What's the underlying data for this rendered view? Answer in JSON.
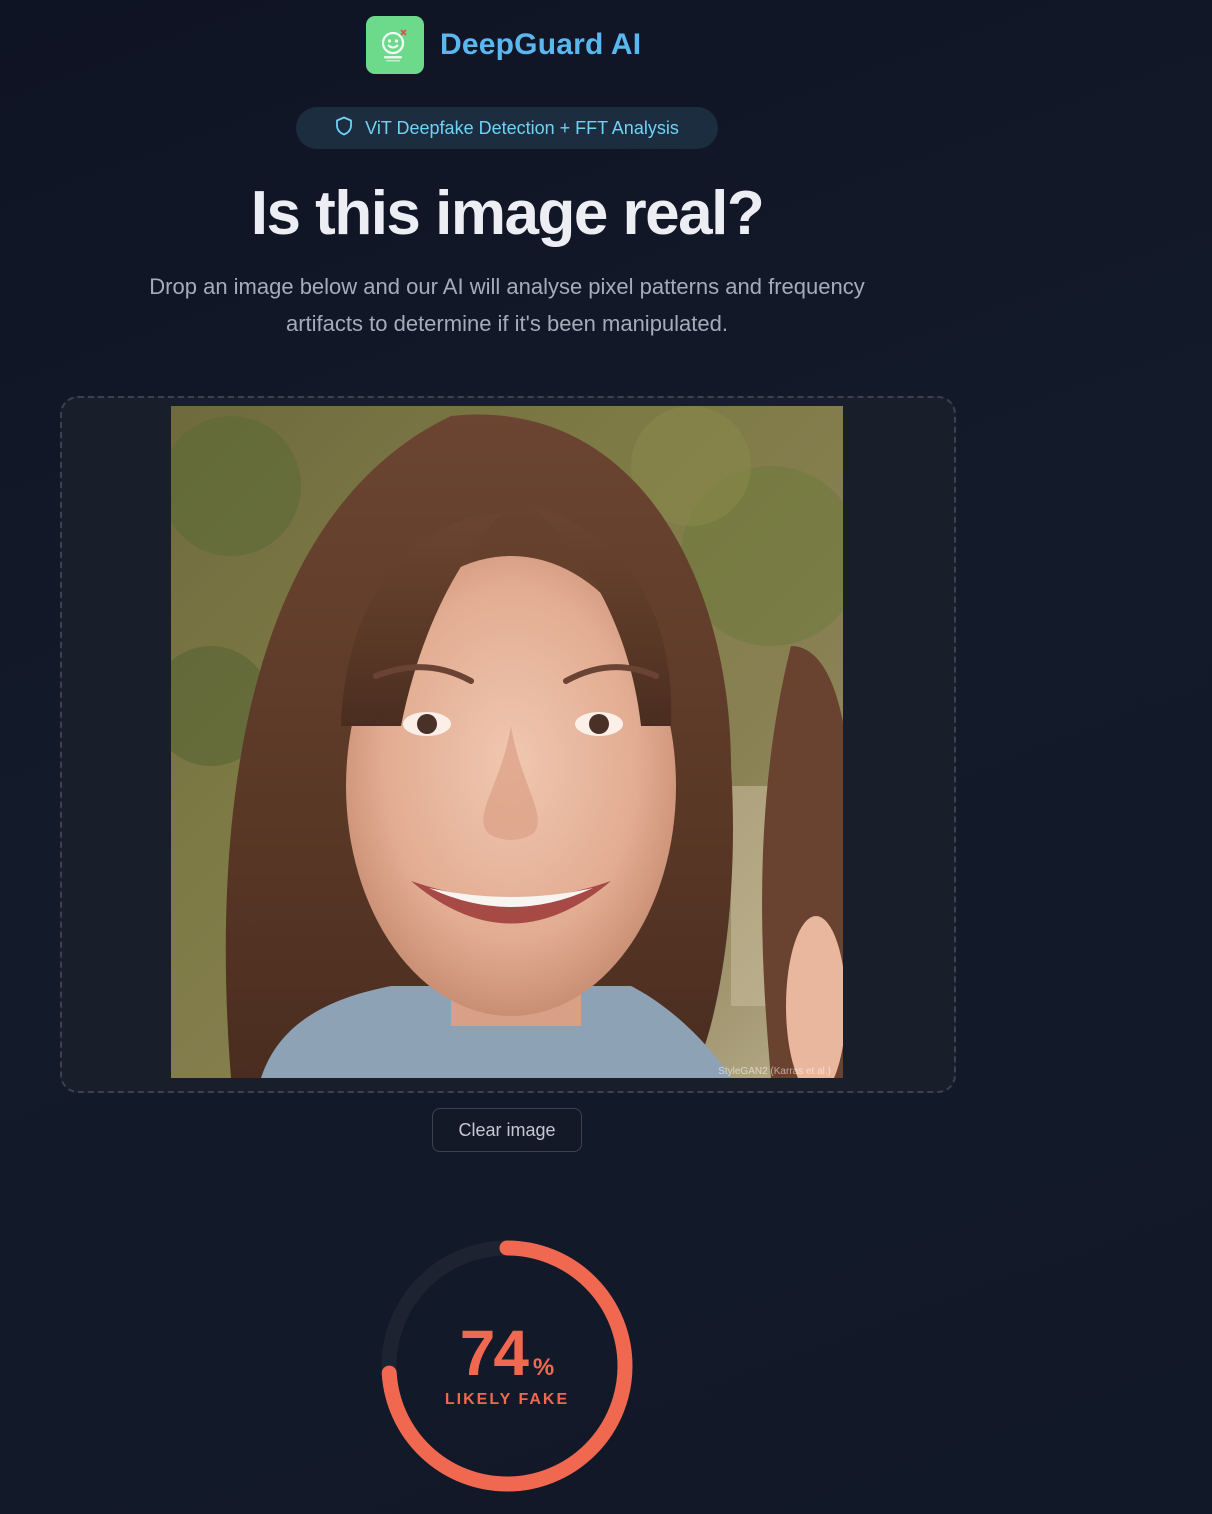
{
  "header": {
    "brand": "DeepGuard AI",
    "logo_icon": "face-scan-icon",
    "logo_color": "#6dd98b"
  },
  "badge": {
    "icon": "shield-icon",
    "label": "ViT Deepfake Detection + FFT Analysis"
  },
  "hero": {
    "title": "Is this image real?",
    "subtitle": "Drop an image below and our AI will analyse pixel patterns and frequency artifacts to determine if it's been manipulated."
  },
  "upload": {
    "image_alt": "Uploaded face photo",
    "watermark": "StyleGAN2 (Karras et al.)",
    "clear_label": "Clear image"
  },
  "result": {
    "score": 74,
    "score_text": "74",
    "unit": "%",
    "verdict": "LIKELY FAKE",
    "accent": "#f0684f",
    "track": "#1d2330"
  }
}
